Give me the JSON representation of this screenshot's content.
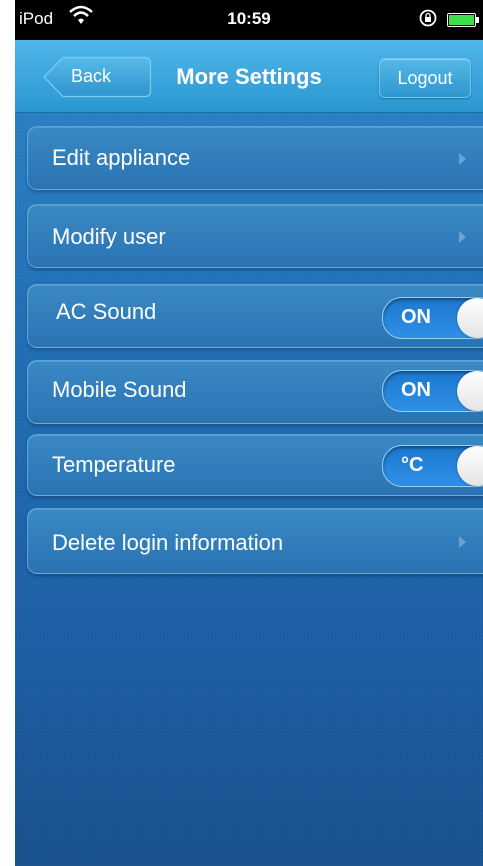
{
  "status_bar": {
    "carrier": "iPod",
    "time": "10:59"
  },
  "nav": {
    "back_label": "Back",
    "title": "More Settings",
    "logout_label": "Logout"
  },
  "menu": {
    "edit_appliance": "Edit appliance",
    "modify_user": "Modify user",
    "ac_sound": {
      "label": "AC Sound",
      "toggle": "ON"
    },
    "mobile_sound": {
      "label": "Mobile Sound",
      "toggle": "ON"
    },
    "temperature": {
      "label": "Temperature",
      "toggle": "°C"
    },
    "delete_login": "Delete login information"
  },
  "colors": {
    "background": "#1f6fb6",
    "nav": "#2a97d2",
    "toggle_on": "#1c78cf",
    "battery": "#3ee04a"
  }
}
